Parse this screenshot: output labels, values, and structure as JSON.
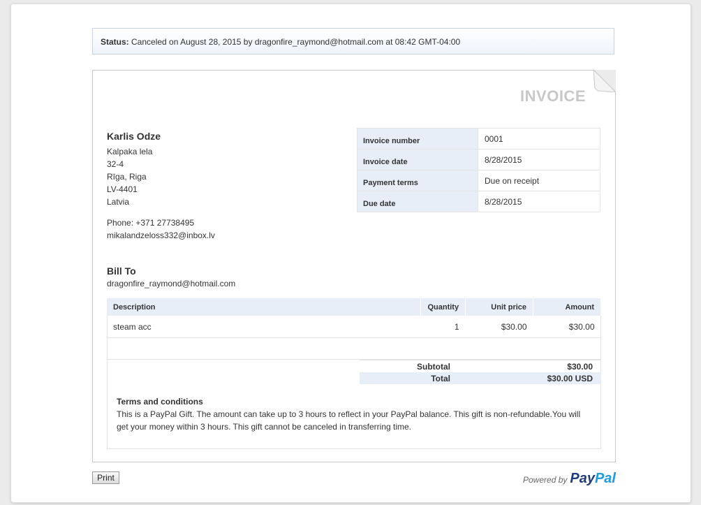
{
  "status": {
    "label": "Status:",
    "text": "Canceled on August 28, 2015 by dragonfire_raymond@hotmail.com at 08:42 GMT-04:00"
  },
  "invoice": {
    "title": "INVOICE",
    "merchant": {
      "name": "Karlis Odze",
      "address": [
        "Kalpaka lela",
        "32-4",
        "Rīga, Riga",
        "LV-4401",
        "Latvia"
      ],
      "phone": "Phone: +371 27738495",
      "email": "mikalandzeloss332@inbox.lv"
    },
    "meta": [
      {
        "label": "Invoice number",
        "value": "0001"
      },
      {
        "label": "Invoice date",
        "value": "8/28/2015"
      },
      {
        "label": "Payment terms",
        "value": "Due on receipt"
      },
      {
        "label": "Due date",
        "value": "8/28/2015"
      }
    ],
    "bill_to": {
      "heading": "Bill To",
      "email": "dragonfire_raymond@hotmail.com"
    },
    "items": {
      "columns": [
        "Description",
        "Quantity",
        "Unit price",
        "Amount"
      ],
      "rows": [
        {
          "description": "steam acc",
          "quantity": "1",
          "unit_price": "$30.00",
          "amount": "$30.00"
        }
      ]
    },
    "totals": {
      "subtotal_label": "Subtotal",
      "subtotal_value": "$30.00",
      "total_label": "Total",
      "total_value": "$30.00 USD"
    },
    "terms": {
      "heading": "Terms and conditions",
      "text": "This is a PayPal Gift. The amount can take up to 3 hours to reflect in your PayPal balance. This gift is non-refundable.You will get your money within 3 hours. This gift cannot be canceled in transferring time."
    }
  },
  "footer": {
    "print_label": "Print",
    "powered_by": "Powered by",
    "brand_pay": "Pay",
    "brand_pal": "Pal"
  },
  "colors": {
    "header_fill": "#e8eef8",
    "paypal_dark": "#1f3d7a",
    "paypal_light": "#1f9be1"
  }
}
